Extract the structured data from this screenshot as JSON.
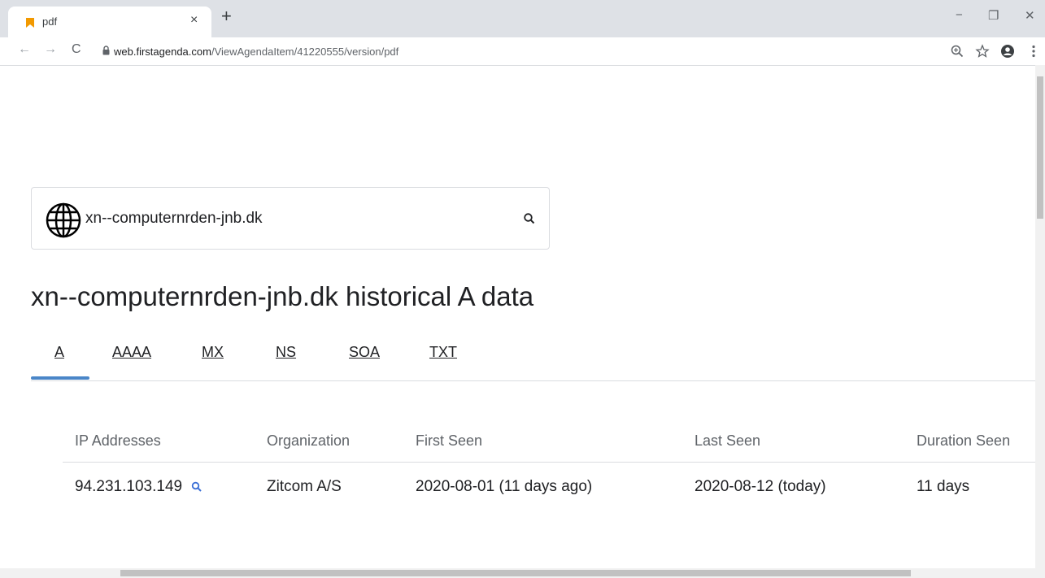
{
  "browser": {
    "tab_title": "pdf",
    "tab_close": "×",
    "new_tab": "+",
    "url_domain": "web.firstagenda.com",
    "url_path": "/ViewAgendaItem/41220555/version/pdf",
    "window_controls": [
      "−",
      "❐",
      "✕"
    ],
    "nav": {
      "back": "←",
      "forward": "→",
      "reload": "C"
    }
  },
  "search": {
    "value": "xn--computernrden-jnb.dk"
  },
  "page": {
    "title": "xn--computernrden-jnb.dk historical A data"
  },
  "record_tabs": [
    {
      "label": "A",
      "active": true
    },
    {
      "label": "AAAA",
      "active": false
    },
    {
      "label": "MX",
      "active": false
    },
    {
      "label": "NS",
      "active": false
    },
    {
      "label": "SOA",
      "active": false
    },
    {
      "label": "TXT",
      "active": false
    }
  ],
  "table": {
    "headers": [
      "IP Addresses",
      "Organization",
      "First Seen",
      "Last Seen",
      "Duration Seen"
    ],
    "rows": [
      [
        "94.231.103.149",
        "Zitcom A/S",
        "2020-08-01 (11 days ago)",
        "2020-08-12 (today)",
        "11 days"
      ]
    ]
  },
  "colors": {
    "accent": "#4a86c8",
    "link_icon": "#3b6fd6",
    "favicon": "#f29900"
  },
  "icons": [
    "globe-icon",
    "search-icon",
    "lock-icon",
    "zoom-icon",
    "star-icon",
    "account-icon",
    "menu-icon"
  ]
}
